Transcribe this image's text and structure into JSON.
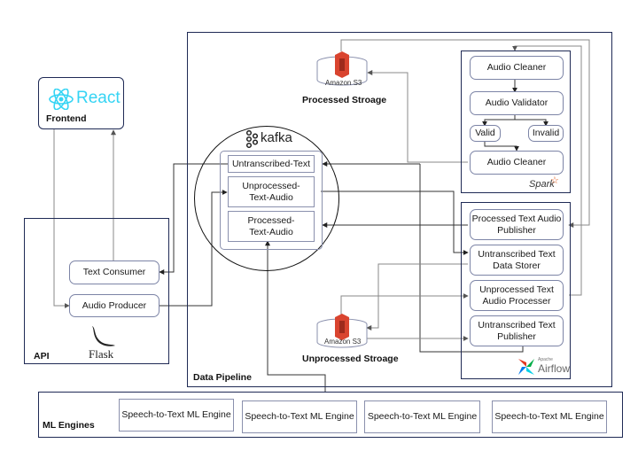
{
  "frontend": {
    "logo_text": "React",
    "label": "Frontend"
  },
  "api": {
    "label": "API",
    "logo_text": "Flask",
    "text_consumer": "Text Consumer",
    "audio_producer": "Audio Producer"
  },
  "data_pipeline": {
    "label": "Data Pipeline",
    "kafka": {
      "logo_text": "kafka",
      "topics": [
        "Untranscribed-Text",
        "Unprocessed-Text-Audio",
        "Processed-Text-Audio"
      ]
    },
    "processed_storage": {
      "s3_label": "Amazon S3",
      "label": "Processed Stroage"
    },
    "unprocessed_storage": {
      "s3_label": "Amazon S3",
      "label": "Unprocessed Stroage"
    },
    "spark": {
      "logo_text": "Spark",
      "audio_cleaner_top": "Audio Cleaner",
      "audio_validator": "Audio Validator",
      "valid": "Valid",
      "invalid": "Invalid",
      "audio_cleaner_bottom": "Audio Cleaner"
    },
    "airflow": {
      "logo_small": "Apache",
      "logo_text": "Airflow",
      "tasks": [
        "Processed Text Audio Publisher",
        "Untranscribed Text Data Storer",
        "Unprocessed Text Audio Processer",
        "Untranscribed Text Publisher"
      ]
    }
  },
  "ml_engines": {
    "label": "ML Engines",
    "engines": [
      "Speech-to-Text ML Engine",
      "Speech-to-Text ML Engine",
      "Speech-to-Text ML Engine",
      "Speech-to-Text ML Engine"
    ]
  },
  "colors": {
    "panel_border": "#1f2a55",
    "react": "#35d4f4",
    "s3_red": "#d9442f",
    "spark_orange": "#e25a1c"
  }
}
